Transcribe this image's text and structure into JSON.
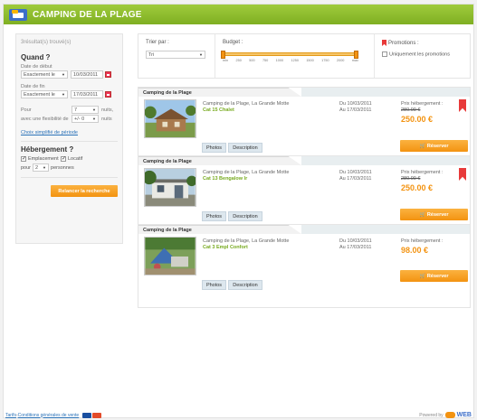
{
  "site": {
    "title": "CAMPING DE LA PLAGE"
  },
  "sidebar": {
    "result_count": "3résultat(s) trouvé(s)",
    "when_title": "Quand ?",
    "start_label": "Date de début",
    "start_mode": "Exactement le",
    "start_date": "10/03/2011",
    "end_label": "Date de fin",
    "end_mode": "Exactement le",
    "end_date": "17/03/2011",
    "for_label": "Pour",
    "nights_value": "7",
    "nights_unit": "nuits,",
    "flex_label": "avec une flexibilité de",
    "flex_value": "+/- 0",
    "flex_unit": "nuits",
    "simple_period_link": "Choix simplifié de période",
    "lodging_title": "Hébergement ?",
    "opt_emplacement": "Emplacement",
    "opt_locatif": "Locatif",
    "persons_prefix": "pour",
    "persons_value": "2",
    "persons_unit": "personnes",
    "search_button": "Relancer la recherche"
  },
  "filters": {
    "sort_label": "Trier par :",
    "sort_value": "Tri",
    "budget_label": "Budget :",
    "budget_ticks": [
      "min",
      "250",
      "500",
      "750",
      "1000",
      "1250",
      "1500",
      "1750",
      "2000",
      "max"
    ],
    "budget_range": [
      "min",
      "max"
    ],
    "promo_label": "Promotions :",
    "promo_only": "Uniquement les promotions"
  },
  "results": [
    {
      "tab": "Camping de la Plage",
      "address": "Camping de la Plage, La Grande Motte",
      "category": "Cat 15 Chalet",
      "date_from": "Du 10/03/2011",
      "date_to": "Au 17/03/2011",
      "price_label": "Prix hébergement :",
      "old_price": "280.00 €",
      "price": "250.00 €",
      "reserve": "Réserver",
      "photos": "Photos",
      "description": "Description"
    },
    {
      "tab": "Camping de la Plage",
      "address": "Camping de la Plage, La Grande Motte",
      "category": "Cat 13 Bengalow Ir",
      "date_from": "Du 10/03/2011",
      "date_to": "Au 17/03/2011",
      "price_label": "Prix hébergement :",
      "old_price": "280.00 €",
      "price": "250.00 €",
      "reserve": "Réserver",
      "photos": "Photos",
      "description": "Description"
    },
    {
      "tab": "Camping de la Plage",
      "address": "Camping de la Plage, La Grande Motte",
      "category": "Cat 3 Empl Confort",
      "date_from": "Du 10/03/2011",
      "date_to": "Au 17/03/2011",
      "price_label": "Prix hébergement :",
      "old_price": "",
      "price": "98.00 €",
      "reserve": "Réserver",
      "photos": "Photos",
      "description": "Description"
    }
  ],
  "footer": {
    "tarifs": "Tarifs",
    "separator": " - ",
    "cgv": "Conditions générales de vente",
    "powered_by": "Powered by",
    "brand": "WEB"
  },
  "colors": {
    "header_green": "#8dbd2c",
    "accent_orange": "#f39311",
    "category_green": "#77aa1f",
    "promo_red": "#e83a3a"
  }
}
